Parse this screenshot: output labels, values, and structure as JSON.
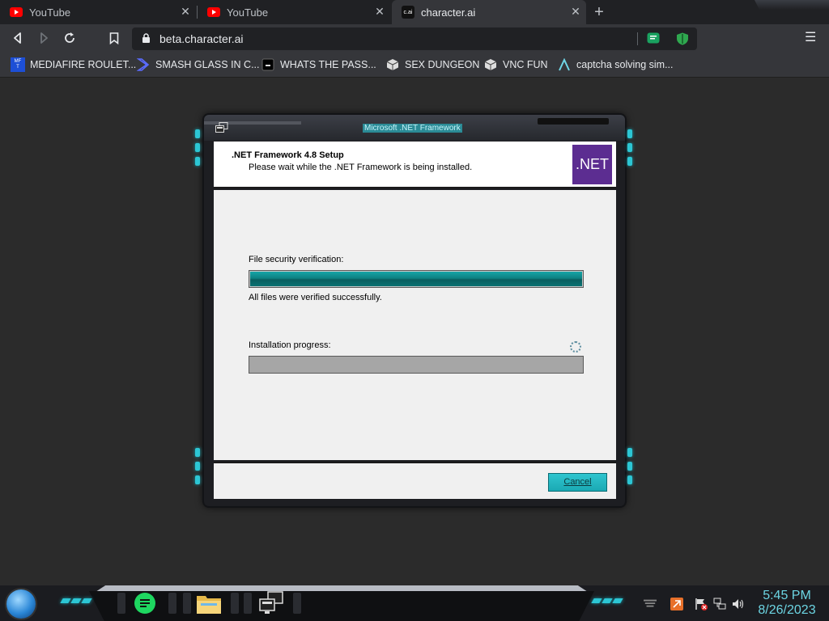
{
  "browser": {
    "tabs": [
      {
        "title": "YouTube",
        "icon": "youtube-icon",
        "active": false
      },
      {
        "title": "YouTube",
        "icon": "youtube-icon",
        "active": false
      },
      {
        "title": "character.ai",
        "icon": "character-ai-icon",
        "active": true
      }
    ],
    "url": "beta.character.ai",
    "bookmarks": [
      {
        "label": "MEDIAFIRE ROULET...",
        "icon": "mediafire-icon"
      },
      {
        "label": "SMASH GLASS IN C...",
        "icon": "bracket-icon"
      },
      {
        "label": "WHATS THE PASS...",
        "icon": "black-square-icon"
      },
      {
        "label": "SEX DUNGEON",
        "icon": "cube-icon"
      },
      {
        "label": "VNC FUN",
        "icon": "cube-icon"
      },
      {
        "label": "captcha solving sim...",
        "icon": "lambda-icon"
      }
    ],
    "tab_favicon_text": "c.ai"
  },
  "installer": {
    "window_title": "Microsoft .NET Framework",
    "title": ".NET Framework 4.8 Setup",
    "subtitle": "Please wait while the .NET Framework is being installed.",
    "logo_text": ".NET",
    "security_label": "File security verification:",
    "security_progress": 1.0,
    "security_status": "All files were verified successfully.",
    "install_label": "Installation progress:",
    "install_progress": 0.0,
    "cancel_label": "Cancel"
  },
  "taskbar": {
    "time": "5:45 PM",
    "date": "8/26/2023"
  },
  "colors": {
    "accent": "#2cc6d4",
    "net_purple": "#5c2d91",
    "progress_teal": "#0d8182"
  }
}
